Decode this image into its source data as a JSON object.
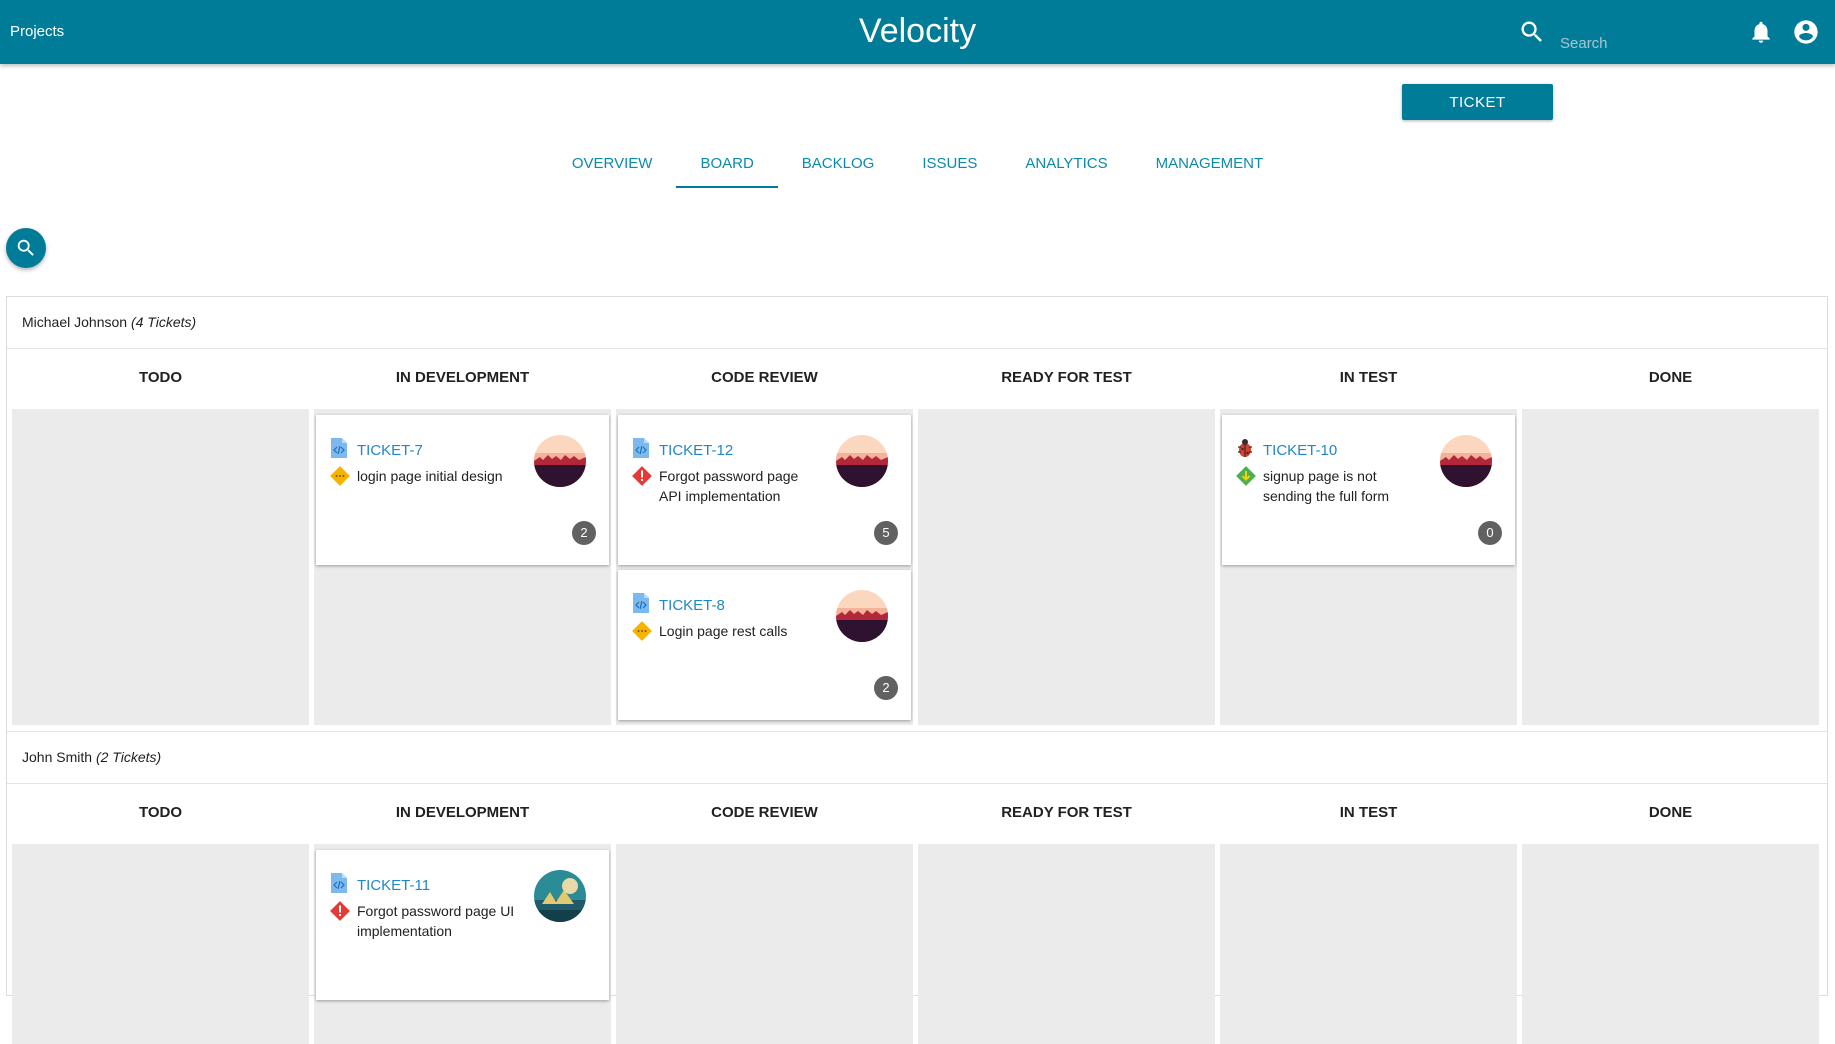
{
  "header": {
    "projects_label": "Projects",
    "app_title": "Velocity",
    "search_placeholder": "Search",
    "brand_color": "#007c98"
  },
  "actions": {
    "ticket_button_label": "TICKET"
  },
  "tabs": [
    {
      "label": "OVERVIEW",
      "active": false
    },
    {
      "label": "BOARD",
      "active": true
    },
    {
      "label": "BACKLOG",
      "active": false
    },
    {
      "label": "ISSUES",
      "active": false
    },
    {
      "label": "ANALYTICS",
      "active": false
    },
    {
      "label": "MANAGEMENT",
      "active": false
    }
  ],
  "columns": [
    "TODO",
    "IN DEVELOPMENT",
    "CODE REVIEW",
    "READY FOR TEST",
    "IN TEST",
    "DONE"
  ],
  "swimlanes": [
    {
      "assignee": "Michael Johnson",
      "count_label": "(4 Tickets)",
      "cards": {
        "in_development": [
          {
            "id": "TICKET-7",
            "summary": "login page initial design",
            "type": "code-file-icon",
            "priority": "medium-priority-icon",
            "comments": "2"
          }
        ],
        "code_review": [
          {
            "id": "TICKET-12",
            "summary": "Forgot password page API implementation",
            "type": "code-file-icon",
            "priority": "high-priority-icon",
            "comments": "5"
          },
          {
            "id": "TICKET-8",
            "summary": "Login page rest calls",
            "type": "code-file-icon",
            "priority": "medium-priority-icon",
            "comments": "2"
          }
        ],
        "in_test": [
          {
            "id": "TICKET-10",
            "summary": "signup page is not sending the full form",
            "type": "bug-icon",
            "priority": "low-priority-icon",
            "comments": "0"
          }
        ]
      }
    },
    {
      "assignee": "John Smith",
      "count_label": "(2 Tickets)",
      "cards": {
        "in_development": [
          {
            "id": "TICKET-11",
            "summary": "Forgot password page UI implementation",
            "type": "code-file-icon",
            "priority": "high-priority-icon"
          }
        ]
      }
    }
  ]
}
